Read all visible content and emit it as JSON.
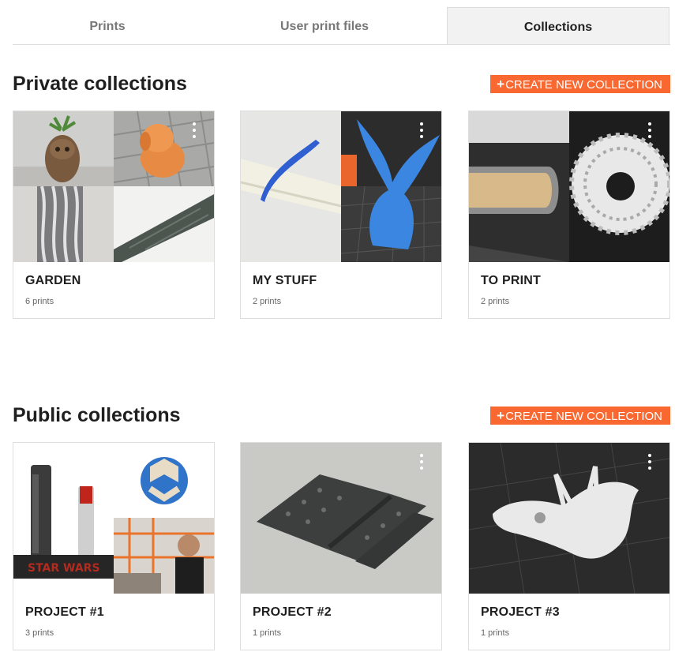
{
  "tabs": [
    {
      "label": "Prints",
      "active": false
    },
    {
      "label": "User print files",
      "active": false
    },
    {
      "label": "Collections",
      "active": true
    }
  ],
  "private_section": {
    "title": "Private collections",
    "create_button": "CREATE NEW COLLECTION",
    "collections": [
      {
        "name": "GARDEN",
        "count": "6 prints"
      },
      {
        "name": "MY STUFF",
        "count": "2 prints"
      },
      {
        "name": "TO PRINT",
        "count": "2 prints"
      }
    ]
  },
  "public_section": {
    "title": "Public collections",
    "create_button": "CREATE NEW COLLECTION",
    "collections": [
      {
        "name": "PROJECT #1",
        "count": "3 prints"
      },
      {
        "name": "PROJECT #2",
        "count": "1 prints"
      },
      {
        "name": "PROJECT #3",
        "count": "1 prints"
      }
    ]
  },
  "colors": {
    "accent": "#fa6831",
    "active_tab_bg": "#f2f2f2",
    "inactive_tab_text": "#777777",
    "text": "#1f1f1f",
    "muted": "#666666"
  },
  "icons": {
    "create": "plus-icon",
    "card_menu": "kebab-menu-icon"
  }
}
